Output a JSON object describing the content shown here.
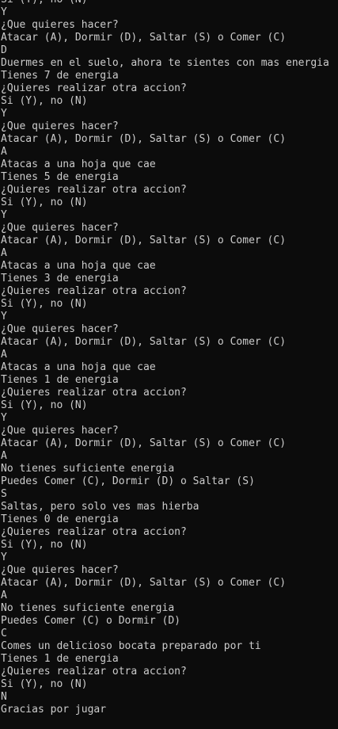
{
  "console": {
    "lines": [
      "Si (Y), no (N)",
      "Y",
      "¿Que quieres hacer?",
      "Atacar (A), Dormir (D), Saltar (S) o Comer (C)",
      "D",
      "Duermes en el suelo, ahora te sientes con mas energia",
      "Tienes 7 de energia",
      "¿Quieres realizar otra accion?",
      "Si (Y), no (N)",
      "Y",
      "¿Que quieres hacer?",
      "Atacar (A), Dormir (D), Saltar (S) o Comer (C)",
      "A",
      "Atacas a una hoja que cae",
      "Tienes 5 de energia",
      "¿Quieres realizar otra accion?",
      "Si (Y), no (N)",
      "Y",
      "¿Que quieres hacer?",
      "Atacar (A), Dormir (D), Saltar (S) o Comer (C)",
      "A",
      "Atacas a una hoja que cae",
      "Tienes 3 de energia",
      "¿Quieres realizar otra accion?",
      "Si (Y), no (N)",
      "Y",
      "¿Que quieres hacer?",
      "Atacar (A), Dormir (D), Saltar (S) o Comer (C)",
      "A",
      "Atacas a una hoja que cae",
      "Tienes 1 de energia",
      "¿Quieres realizar otra accion?",
      "Si (Y), no (N)",
      "Y",
      "¿Que quieres hacer?",
      "Atacar (A), Dormir (D), Saltar (S) o Comer (C)",
      "A",
      "No tienes suficiente energia",
      "Puedes Comer (C), Dormir (D) o Saltar (S)",
      "S",
      "Saltas, pero solo ves mas hierba",
      "Tienes 0 de energia",
      "¿Quieres realizar otra accion?",
      "Si (Y), no (N)",
      "Y",
      "¿Que quieres hacer?",
      "Atacar (A), Dormir (D), Saltar (S) o Comer (C)",
      "A",
      "No tienes suficiente energia",
      "Puedes Comer (C) o Dormir (D)",
      "C",
      "Comes un delicioso bocata preparado por ti",
      "Tienes 1 de energia",
      "¿Quieres realizar otra accion?",
      "Si (Y), no (N)",
      "N",
      "Gracias por jugar"
    ]
  }
}
